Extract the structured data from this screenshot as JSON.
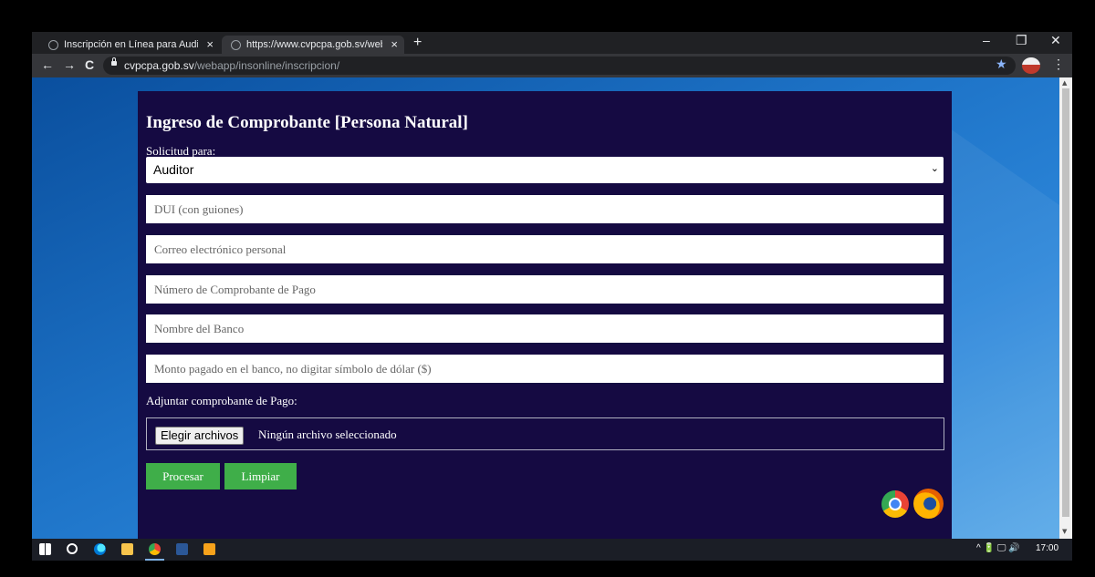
{
  "browser": {
    "tabs": [
      {
        "title": "Inscripción en Línea para Auditor",
        "active": false
      },
      {
        "title": "https://www.cvpcpa.gob.sv/webapp",
        "active": true
      }
    ],
    "new_tab_label": "+",
    "url_host": "cvpcpa.gob.sv",
    "url_path": "/webapp/insonline/inscripcion/",
    "window_controls": {
      "minimize": "–",
      "maximize": "❐",
      "close": "✕"
    },
    "nav": {
      "back": "←",
      "forward": "→",
      "reload": "C"
    },
    "bookmark_star": "★",
    "menu": "⋮"
  },
  "form": {
    "title": "Ingreso de Comprobante [Persona Natural]",
    "request_label": "Solicitud para:",
    "request_value": "Auditor",
    "fields": {
      "dui": "DUI (con guiones)",
      "email": "Correo electrónico personal",
      "receipt_number": "Número de Comprobante de Pago",
      "bank_name": "Nombre del Banco",
      "amount": "Monto pagado en el banco, no digitar símbolo de dólar ($)"
    },
    "attach_label": "Adjuntar comprobante de Pago:",
    "file_button": "Elegir archivos",
    "file_status": "Ningún archivo seleccionado",
    "process_button": "Procesar",
    "clear_button": "Limpiar"
  },
  "taskbar": {
    "tray_icons": "^ 🔋 🖵 🔊",
    "clock": "17:00"
  },
  "icons": [
    "globe-icon",
    "lock-icon",
    "star-icon",
    "profile-avatar-icon",
    "chevron-down-icon",
    "chrome-logo-icon",
    "firefox-logo-icon",
    "windows-start-icon",
    "search-icon",
    "edge-icon",
    "file-explorer-icon",
    "chrome-icon",
    "word-icon",
    "media-player-icon"
  ],
  "colors": {
    "panel_bg": "#150a42",
    "button_green": "#3fae49",
    "desktop_blue": "#1a6db8"
  }
}
